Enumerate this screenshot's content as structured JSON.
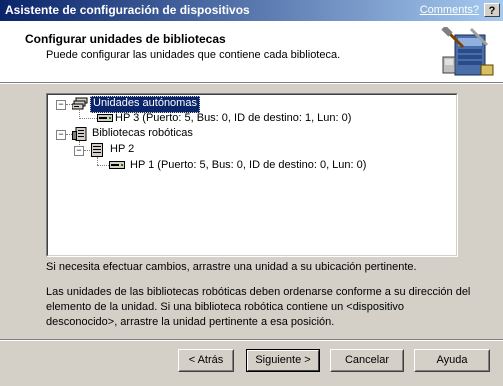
{
  "window": {
    "title": "Asistente de configuración de dispositivos",
    "comments_link": "Comments?",
    "help_button": "?"
  },
  "header": {
    "title": "Configurar unidades de bibliotecas",
    "subtitle": "Puede configurar las unidades que contiene cada biblioteca."
  },
  "tree": {
    "standalone_group": "Unidades autónomas",
    "standalone_drive": "HP 3 (Puerto: 5, Bus: 0, ID de destino: 1, Lun: 0)",
    "robotic_group": "Bibliotecas robóticas",
    "robotic_library": "HP 2",
    "robotic_drive": "HP 1 (Puerto: 5, Bus: 0, ID de destino: 0, Lun: 0)",
    "collapse_glyph": "−"
  },
  "instructions": {
    "line1": "Si necesita efectuar cambios, arrastre una unidad a su ubicación pertinente.",
    "para2_line1": "Las unidades de las bibliotecas robóticas deben ordenarse conforme a su dirección del",
    "para2_line2": "elemento de la unidad. Si una biblioteca robótica contiene un <dispositivo",
    "para2_line3": "desconocido>, arrastre la unidad pertinente a esa posición."
  },
  "buttons": {
    "back": "< Atrás",
    "next": "Siguiente >",
    "cancel": "Cancelar",
    "help": "Ayuda"
  },
  "icons": {
    "header": "wizard-tools-icon",
    "standalone": "drive-stack-icon",
    "drive": "tape-drive-icon",
    "library": "robotic-library-icon"
  }
}
